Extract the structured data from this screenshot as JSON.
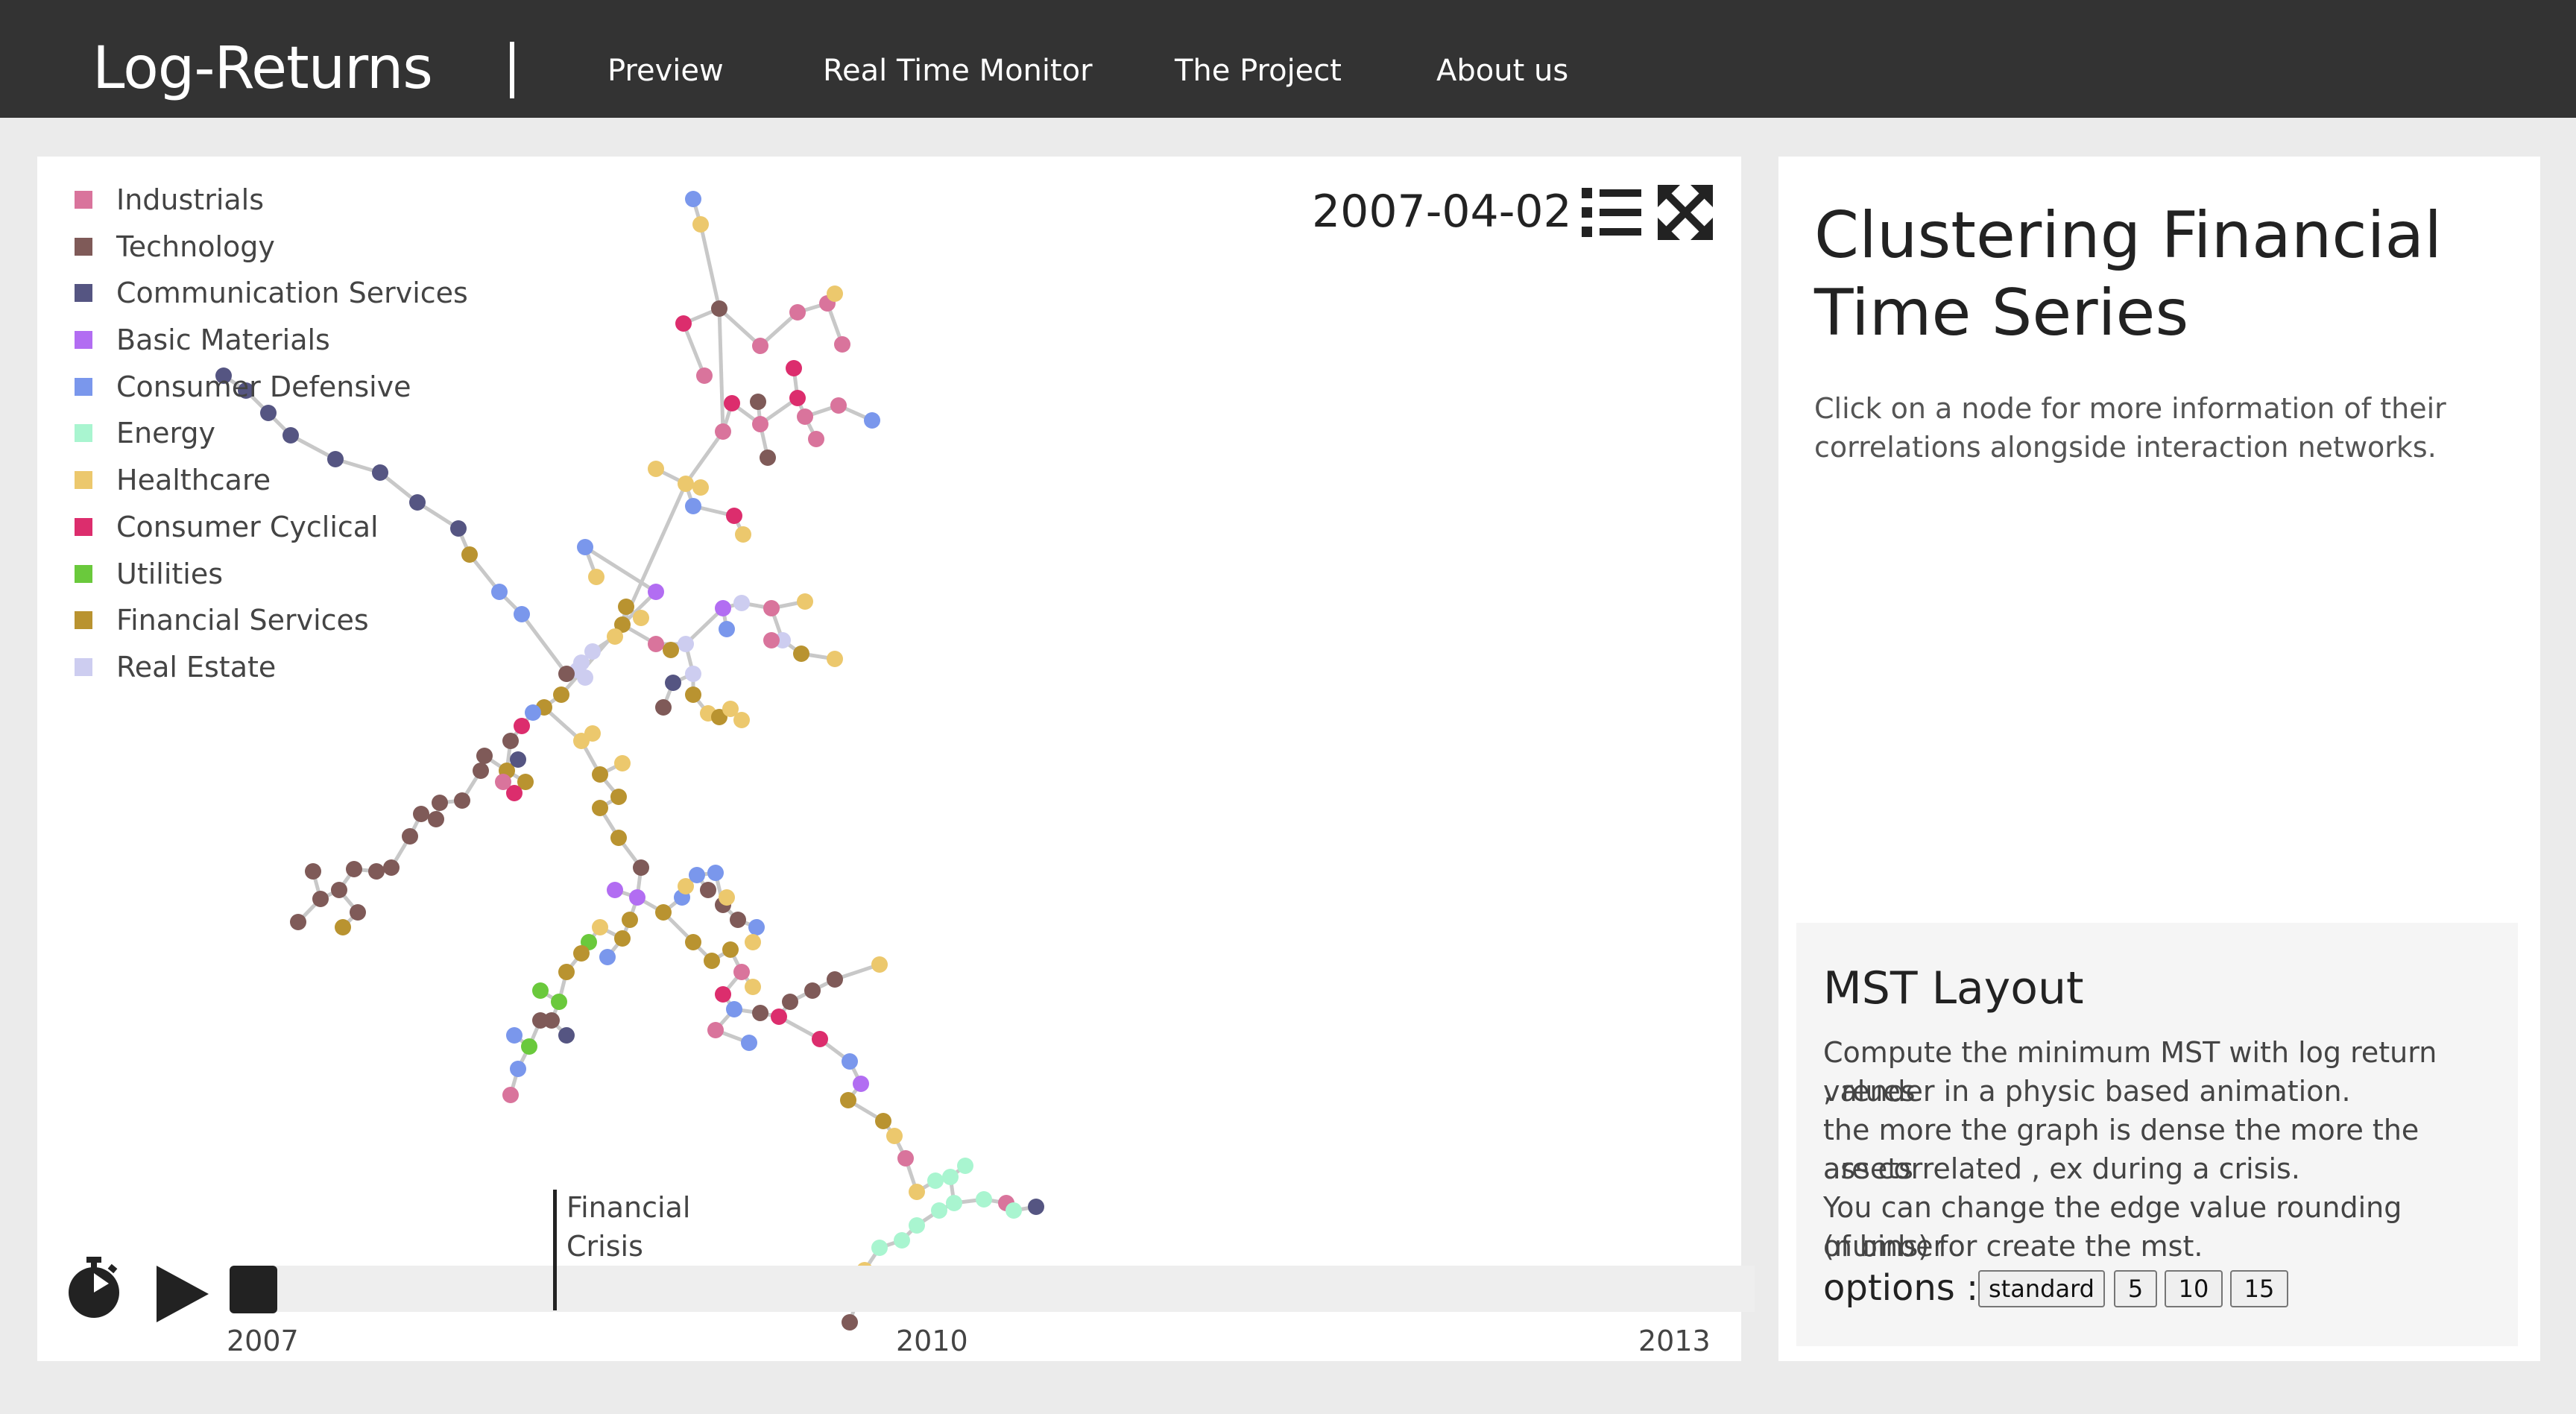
{
  "nav": {
    "brand": "Log-Returns",
    "links": [
      "Preview",
      "Real Time Monitor",
      "The Project",
      "About us"
    ]
  },
  "legend": [
    {
      "label": "Industrials",
      "color": "#d9749c"
    },
    {
      "label": "Technology",
      "color": "#7f5a58"
    },
    {
      "label": "Communication Services",
      "color": "#555582"
    },
    {
      "label": "Basic Materials",
      "color": "#b26df2"
    },
    {
      "label": "Consumer Defensive",
      "color": "#7a97ec"
    },
    {
      "label": "Energy",
      "color": "#a9f5d0"
    },
    {
      "label": "Healthcare",
      "color": "#ecc86d"
    },
    {
      "label": "Consumer Cyclical",
      "color": "#dc2d6d"
    },
    {
      "label": "Utilities",
      "color": "#6ac93c"
    },
    {
      "label": "Financial Services",
      "color": "#b99330"
    },
    {
      "label": "Real Estate",
      "color": "#cdcdf0"
    }
  ],
  "date": "2007-04-02",
  "icons": {
    "list": "list-icon",
    "expand": "expand-icon",
    "timer": "stopwatch-icon",
    "play": "play-icon",
    "stop": "stop-icon"
  },
  "timeline": {
    "event_label": "Financial\nCrisis",
    "ticks": [
      "2007",
      "2010",
      "2013"
    ]
  },
  "info": {
    "title": "Clustering Financial Time Series",
    "intro": "Click on a node for more information of their correlations alongside interaction networks.",
    "mst": {
      "title": "MST Layout",
      "lines": [
        "Compute the minimum MST with log return values",
        ", render in a physic based animation.",
        "the more the graph is dense the more the assets",
        "are correlated , ex during a crisis.",
        "You can change the edge value rounding (number",
        "of bins) for create the mst."
      ],
      "options_label": "options :",
      "options": [
        "standard",
        "5",
        "10",
        "15"
      ]
    }
  }
}
